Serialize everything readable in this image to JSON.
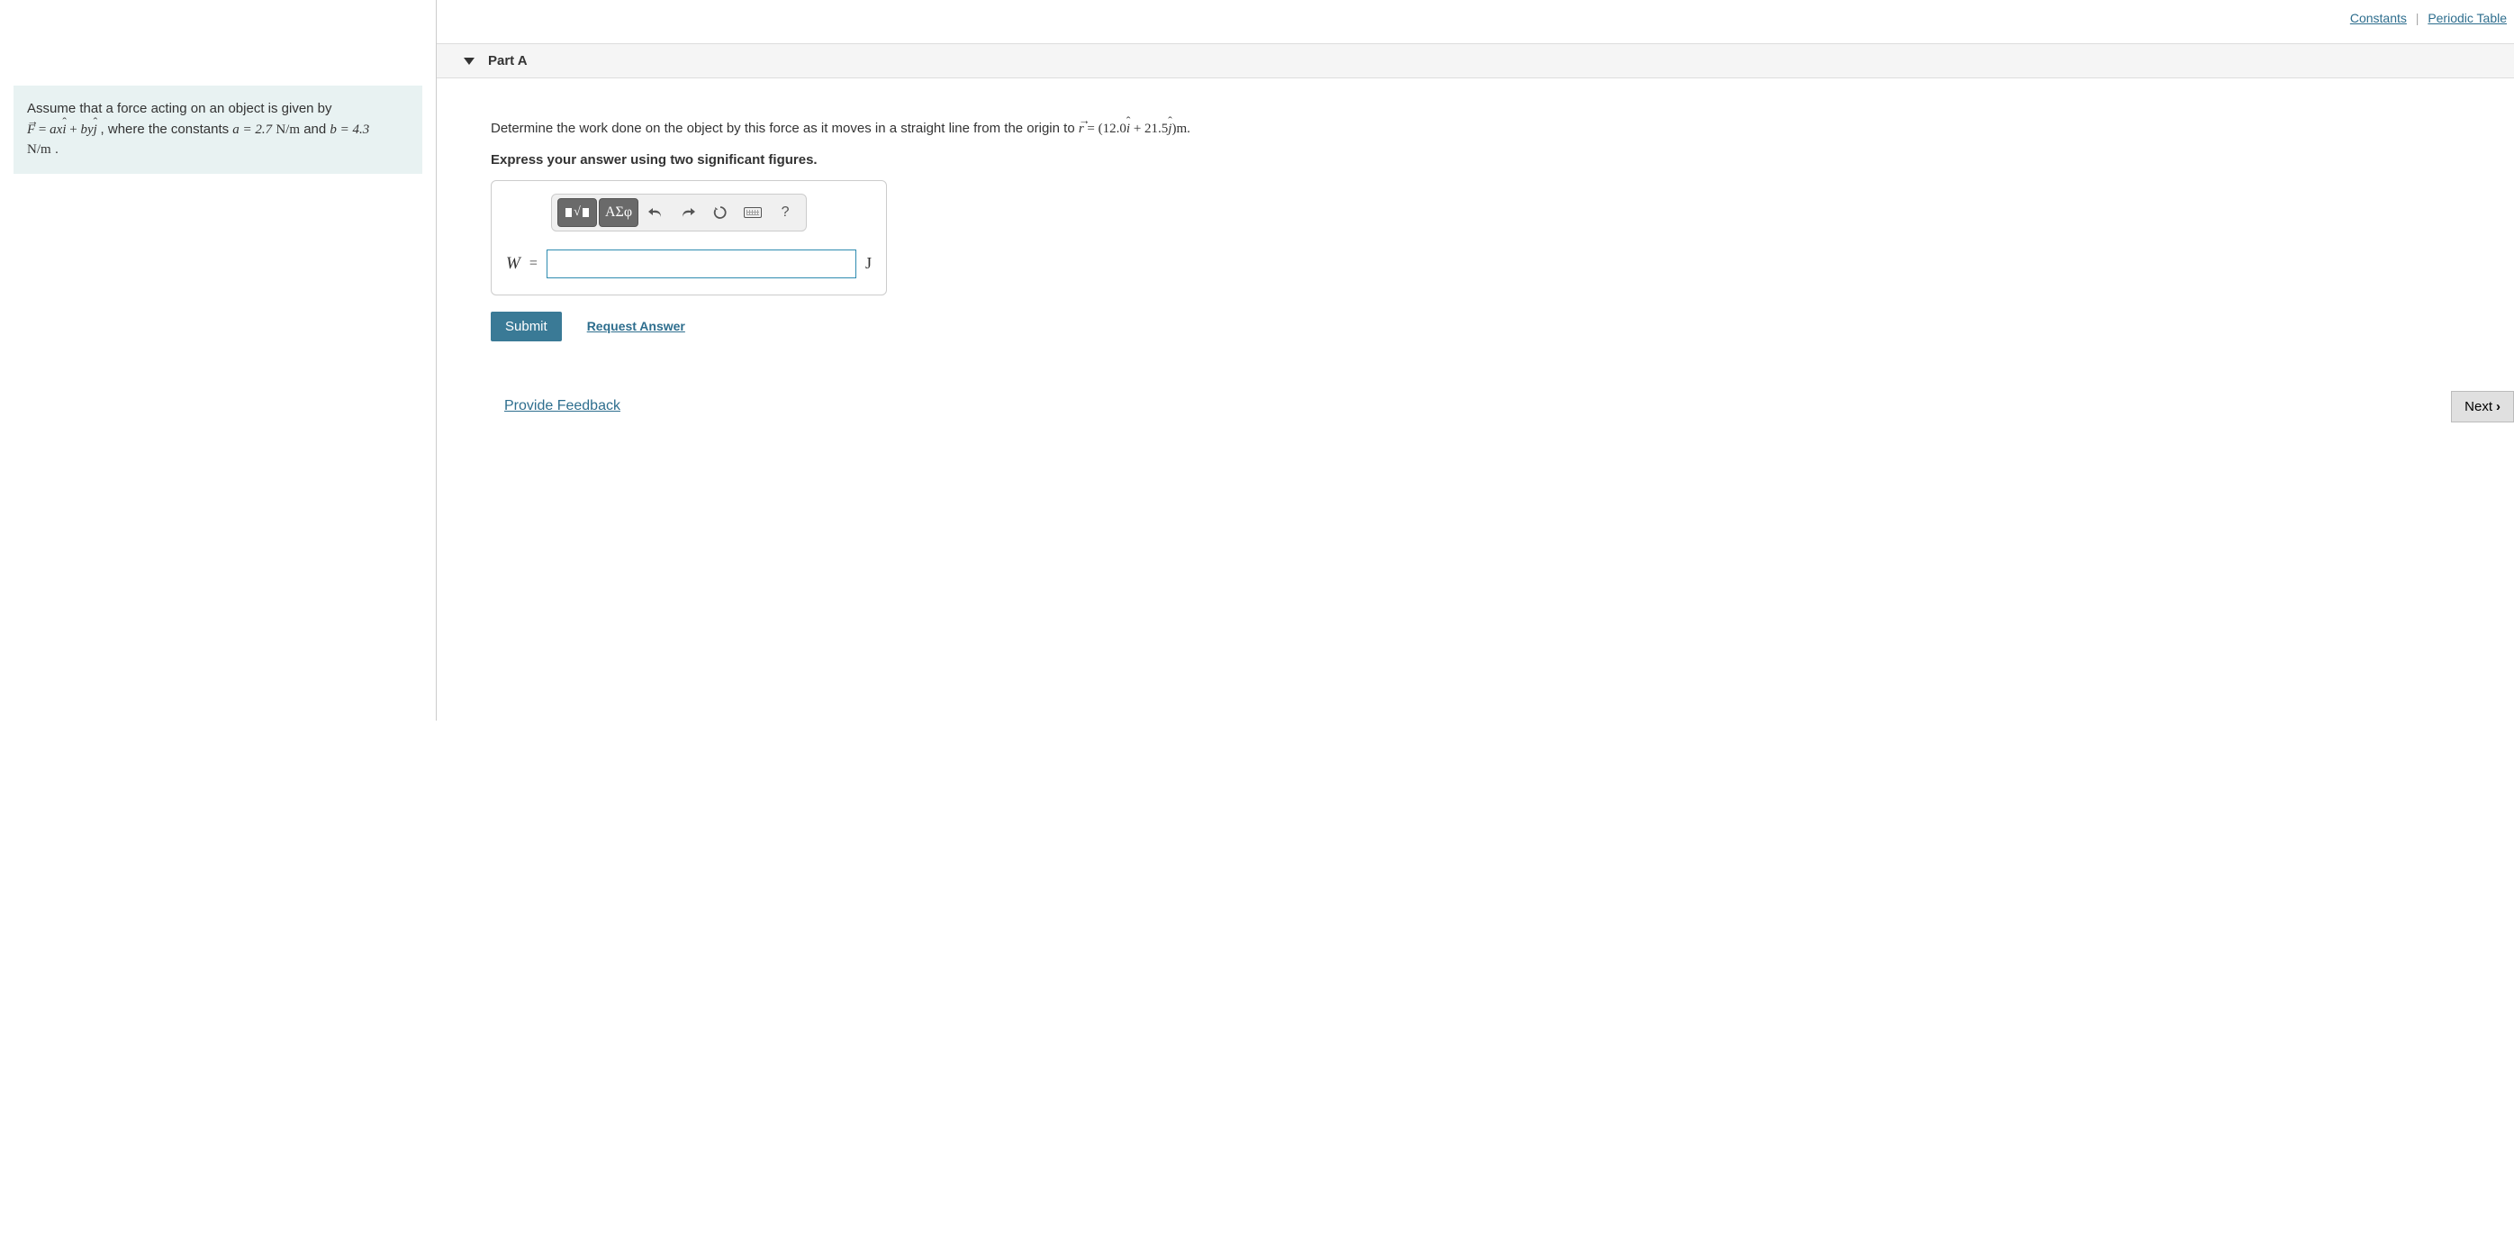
{
  "topLinks": {
    "constants": "Constants",
    "periodic": "Periodic Table"
  },
  "problem": {
    "intro": "Assume that a force acting on an object is given by",
    "constants_text": ", where the constants ",
    "a_eq": "a = 2.7",
    "units1": "N/m",
    "and": " and ",
    "b_eq": "b = 4.3",
    "units2": "N/m",
    "period": " ."
  },
  "part": {
    "title": "Part A",
    "question_prefix": "Determine the work done on the object by this force as it moves in a straight line from the origin to ",
    "r_vec_val": "(12.0",
    "r_vec_mid": " + 21.5",
    "r_vec_end": ")m.",
    "instruction": "Express your answer using two significant figures.",
    "toolbar": {
      "templates": "templates",
      "greek": "ΑΣφ",
      "undo": "undo",
      "redo": "redo",
      "reset": "reset",
      "keyboard": "keyboard",
      "help": "?"
    },
    "var_label": "W",
    "eq": "=",
    "unit": "J",
    "input_value": "",
    "submit": "Submit",
    "request": "Request Answer"
  },
  "footer": {
    "feedback": "Provide Feedback",
    "next": "Next"
  }
}
